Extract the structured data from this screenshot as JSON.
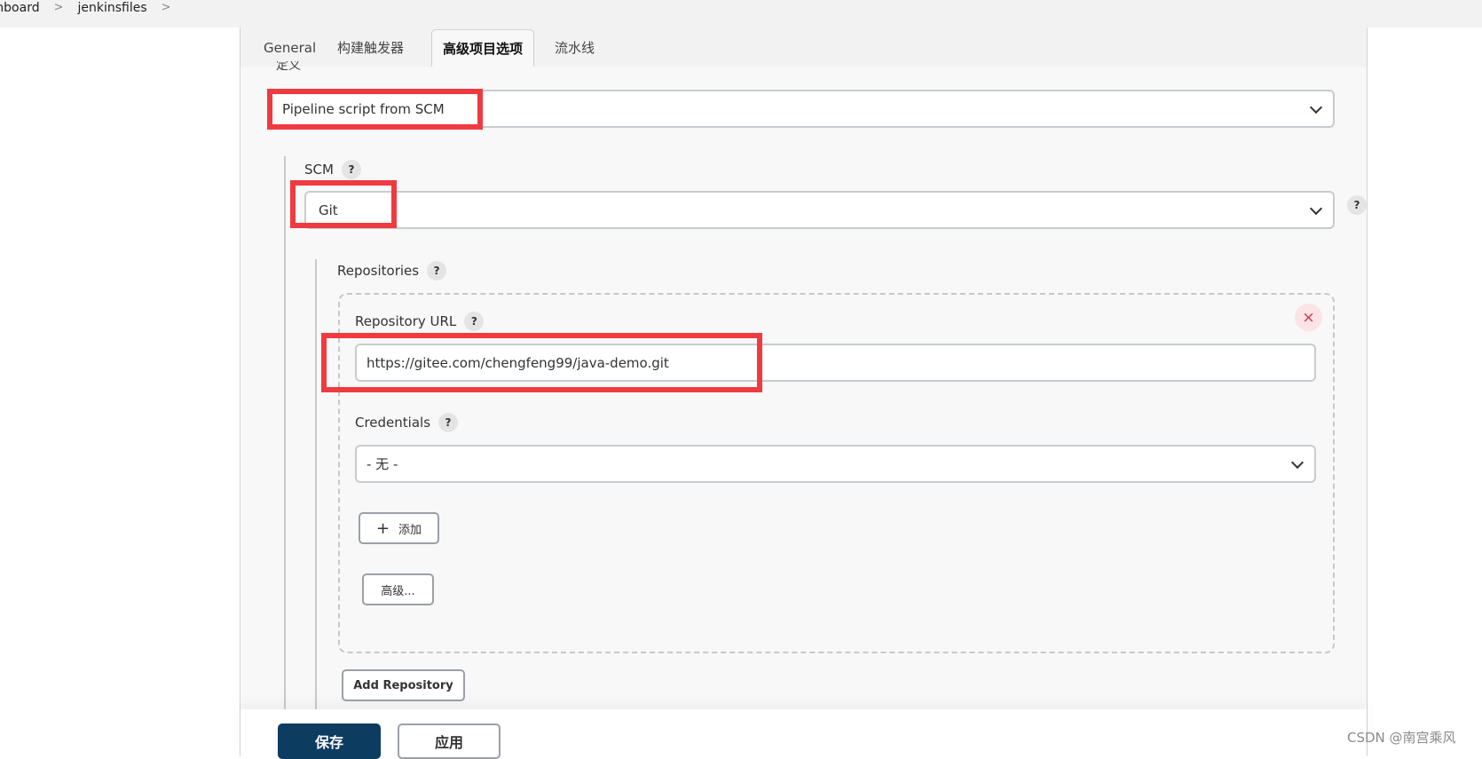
{
  "breadcrumb": {
    "items": [
      "shboard",
      "jenkinsfiles"
    ]
  },
  "tabs": [
    {
      "label": "General",
      "active": false
    },
    {
      "label": "构建触发器",
      "active": false
    },
    {
      "label": "高级项目选项",
      "active": true
    },
    {
      "label": "流水线",
      "active": false
    }
  ],
  "definition": {
    "label": "定义",
    "value": "Pipeline script from SCM"
  },
  "scm": {
    "label": "SCM",
    "help": "?",
    "value": "Git"
  },
  "repositories": {
    "label": "Repositories",
    "help": "?",
    "repository_url": {
      "label": "Repository URL",
      "help": "?",
      "value": "https://gitee.com/chengfeng99/java-demo.git"
    },
    "credentials": {
      "label": "Credentials",
      "help": "?",
      "value": "- 无 -"
    },
    "add_label": "添加",
    "add_icon": "+",
    "advanced_label": "高级...",
    "close_icon": "×",
    "add_repository_label": "Add Repository"
  },
  "footer": {
    "save_label": "保存",
    "apply_label": "应用"
  },
  "watermark": "CSDN @南宫乘风",
  "colors": {
    "accent": "#0d3c61",
    "highlight": "#ef3b3f"
  }
}
